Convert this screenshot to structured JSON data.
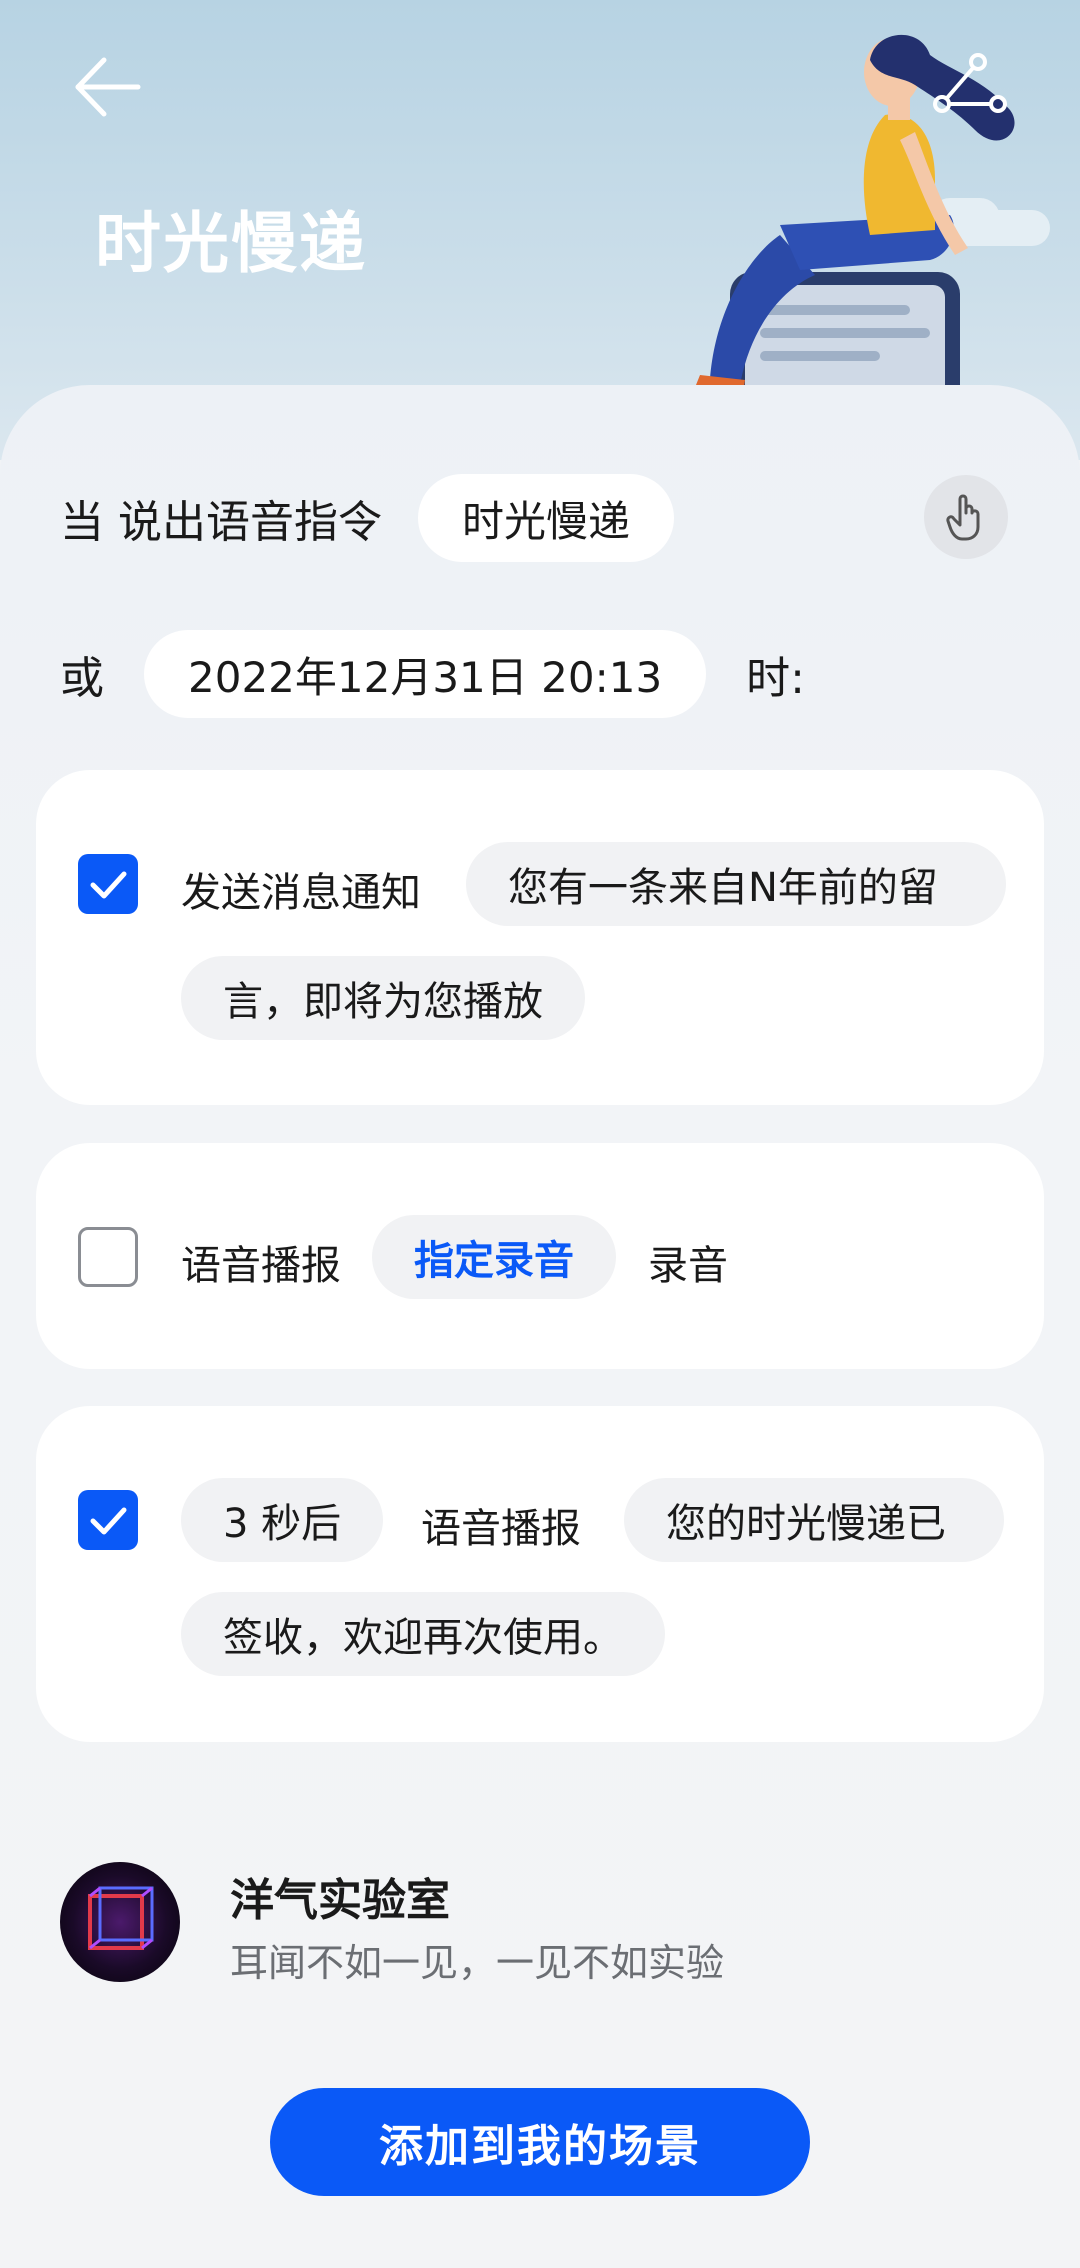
{
  "header": {
    "title": "时光慢递",
    "back_icon": "arrow-left-icon",
    "share_icon": "share-icon"
  },
  "trigger": {
    "when_label": "当 说出语音指令",
    "voice_command": "时光慢递",
    "gesture_icon": "hand-touch-icon",
    "or_label": "或",
    "datetime": "2022年12月31日 20:13",
    "at_label": "时:"
  },
  "actions": [
    {
      "checked": true,
      "label": "发送消息通知",
      "message_line1": "您有一条来自N年前的留",
      "message_line2": "言，即将为您播放"
    },
    {
      "checked": false,
      "label": "语音播报",
      "option": "指定录音",
      "suffix": "录音"
    },
    {
      "checked": true,
      "delay": "3 秒后",
      "label": "语音播报",
      "message_line1": "您的时光慢递已",
      "message_line2": "签收，欢迎再次使用。"
    }
  ],
  "author": {
    "name": "洋气实验室",
    "description": "耳闻不如一见，一见不如实验"
  },
  "add_button": "添加到我的场景",
  "colors": {
    "accent": "#0a59f7",
    "sheet": "#f2f4f7",
    "hero": "#b7d3e3"
  }
}
